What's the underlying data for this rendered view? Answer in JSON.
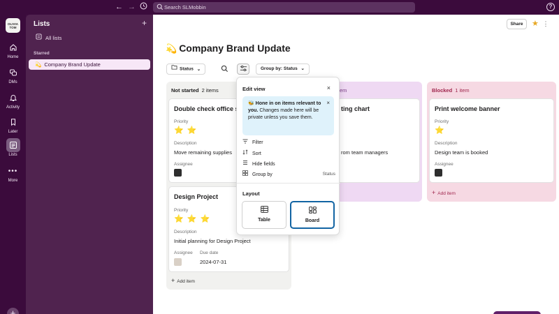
{
  "topbar": {
    "search_text": "Search SLMobbin",
    "help_label": "?"
  },
  "workspace": {
    "logo_text": "OLIVIA TOM"
  },
  "rail": {
    "items": [
      {
        "label": "Home",
        "icon": "home-icon"
      },
      {
        "label": "DMs",
        "icon": "dms-icon"
      },
      {
        "label": "Activity",
        "icon": "bell-icon"
      },
      {
        "label": "Later",
        "icon": "bookmark-icon"
      },
      {
        "label": "Lists",
        "icon": "lists-icon"
      },
      {
        "label": "More",
        "icon": "more-icon"
      }
    ],
    "add_label": "+"
  },
  "sidebar": {
    "title": "Lists",
    "add_label": "+",
    "all_lists": "All lists",
    "starred_header": "Starred",
    "starred_items": [
      {
        "label": "Company Brand Update",
        "emoji": "💫"
      }
    ]
  },
  "header": {
    "title": "Company Brand Update",
    "emoji": "💫",
    "share_label": "Share",
    "star_glyph": "★",
    "more_glyph": "⋮"
  },
  "toolbar": {
    "status_label": "Status",
    "group_by_label": "Group by: Status"
  },
  "columns": [
    {
      "name": "Not started",
      "count": "2 items",
      "color": "#f1f1ef",
      "cards": [
        {
          "title": "Double check office s",
          "priority_label": "Priority",
          "stars": "⭐ ⭐",
          "description_label": "Description",
          "description": "Move remaining supplies",
          "assignee_label": "Assignee"
        },
        {
          "title": "Design Project",
          "priority_label": "Priority",
          "stars": "⭐ ⭐ ⭐",
          "description_label": "Description",
          "description": "Initial planning for Design Project",
          "assignee_label": "Assignee",
          "due_label": "Due date",
          "due_date": "2024-07-31"
        }
      ],
      "add_label": "Add item"
    },
    {
      "name": "",
      "count": "em",
      "color": "#efd9f3",
      "cards": [
        {
          "title": "ting chart",
          "description": "rom team managers"
        }
      ]
    },
    {
      "name": "Blocked",
      "count": "1 item",
      "color": "#f6d9e3",
      "cards": [
        {
          "title": "Print welcome banner",
          "priority_label": "Priority",
          "stars": "⭐",
          "description_label": "Description",
          "description": "Design team is booked",
          "assignee_label": "Assignee"
        }
      ],
      "add_label": "Add item"
    }
  ],
  "edit_view": {
    "title": "Edit view",
    "close_glyph": "×",
    "tip_bold": "🐝 Hone in on items relevant to you.",
    "tip_text": " Changes made here will be private unless you save them.",
    "menu": [
      {
        "label": "Filter",
        "icon": "filter-icon"
      },
      {
        "label": "Sort",
        "icon": "sort-icon"
      },
      {
        "label": "Hide fields",
        "icon": "hide-fields-icon"
      },
      {
        "label": "Group by",
        "icon": "group-by-icon",
        "value": "Status"
      }
    ],
    "layout_title": "Layout",
    "layout_options": [
      {
        "label": "Table",
        "selected": false
      },
      {
        "label": "Board",
        "selected": true
      }
    ]
  },
  "colors": {
    "accent": "#1264a3",
    "aubergine": "#3f0e40",
    "sidebar": "#50234f"
  }
}
